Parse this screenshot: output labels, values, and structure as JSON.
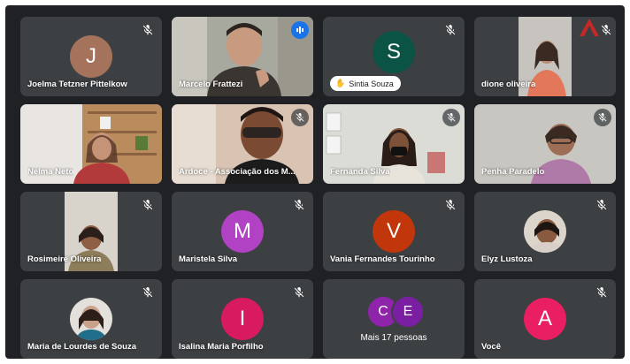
{
  "participants": [
    {
      "name": "Joelma Tetzner Pittelkow",
      "initial": "J",
      "avatar_color": "#a5725c",
      "muted": true
    },
    {
      "name": "Marcelo Frattezi",
      "speaking": true
    },
    {
      "name": "Sintia Souza",
      "initial": "S",
      "avatar_color": "#0b5345",
      "muted": true
    },
    {
      "name": "dione oliveira",
      "muted": true
    },
    {
      "name": "Nelma Neto",
      "muted": false
    },
    {
      "name": "Ardoce - Associação dos M...",
      "muted": true
    },
    {
      "name": "Fernanda Silva",
      "muted": true
    },
    {
      "name": "Penha Paradelo",
      "muted": true
    },
    {
      "name": "Rosimeire Oliveira",
      "muted": true
    },
    {
      "name": "Maristela Silva",
      "initial": "M",
      "avatar_color": "#b042c3",
      "muted": true
    },
    {
      "name": "Vania Fernandes Tourinho",
      "initial": "V",
      "avatar_color": "#c2360c",
      "muted": true
    },
    {
      "name": "Elyz Lustoza",
      "muted": true
    },
    {
      "name": "Maria de Lourdes de Souza",
      "muted": true
    },
    {
      "name": "Isalina Maria Porfilho",
      "initial": "I",
      "avatar_color": "#d81b60",
      "muted": true
    },
    {
      "name": "Você",
      "initial": "A",
      "avatar_color": "#e91e63",
      "muted": true
    }
  ],
  "overflow": {
    "label": "Mais 17 pessoas",
    "avatars": [
      {
        "initial": "C",
        "color": "#8e24aa"
      },
      {
        "initial": "E",
        "color": "#7b1fa2"
      }
    ]
  },
  "colors": {
    "tile_bg": "#3c4043",
    "frame_bg": "#202124",
    "speaking_ring": "#8ab4f8"
  },
  "icons": [
    "mic-off-icon",
    "speaking-indicator-icon",
    "hand-raised-icon",
    "logo-mark-icon"
  ]
}
